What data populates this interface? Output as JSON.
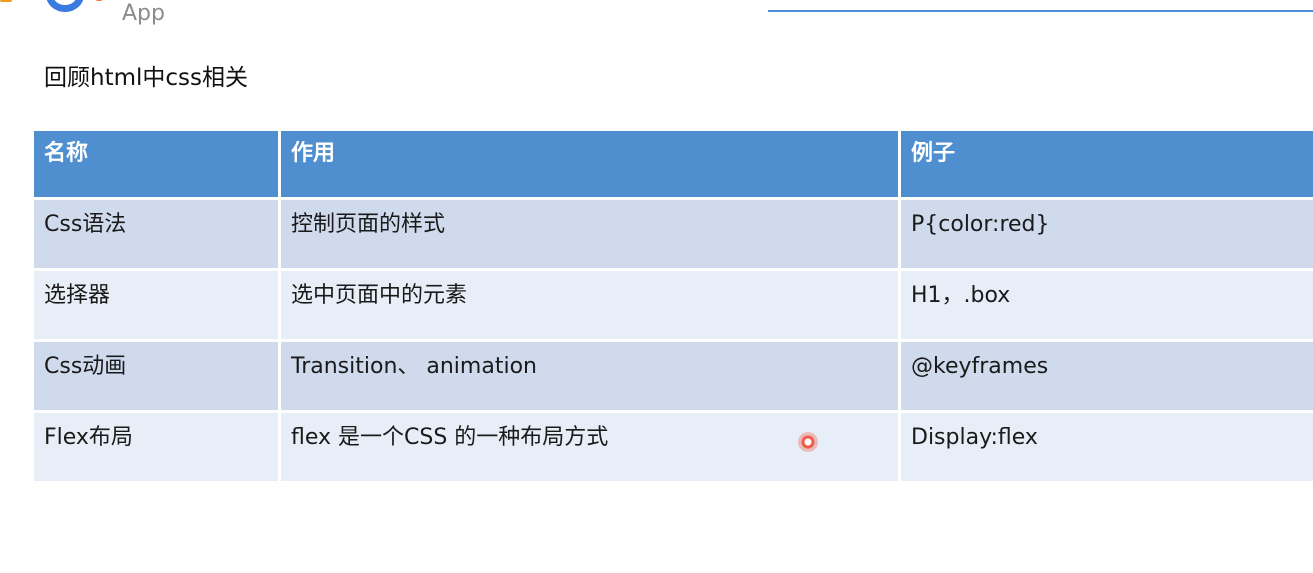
{
  "app": {
    "logo_text": "Quick App"
  },
  "slide": {
    "heading": "回顾html中css相关"
  },
  "table": {
    "headers": [
      "名称",
      "作用",
      "例子"
    ],
    "rows": [
      [
        "Css语法",
        "控制页面的样式",
        "P{color:red}"
      ],
      [
        "选择器",
        "选中页面中的元素",
        "H1，.box"
      ],
      [
        "Css动画",
        "Transition、 animation",
        "@keyframes"
      ],
      [
        "Flex布局",
        "flex 是一个CSS 的一种布局方式",
        "Display:flex"
      ]
    ]
  },
  "colors": {
    "header_bg": "#4f8fcf",
    "row_odd": "#cfdbed",
    "row_even": "#e8eef7",
    "brand_blue": "#3a7be0",
    "brand_orange": "#f26522"
  },
  "icons": {
    "logo": "quick-app-logo-icon",
    "cursor": "mouse-cursor-highlight-icon"
  }
}
